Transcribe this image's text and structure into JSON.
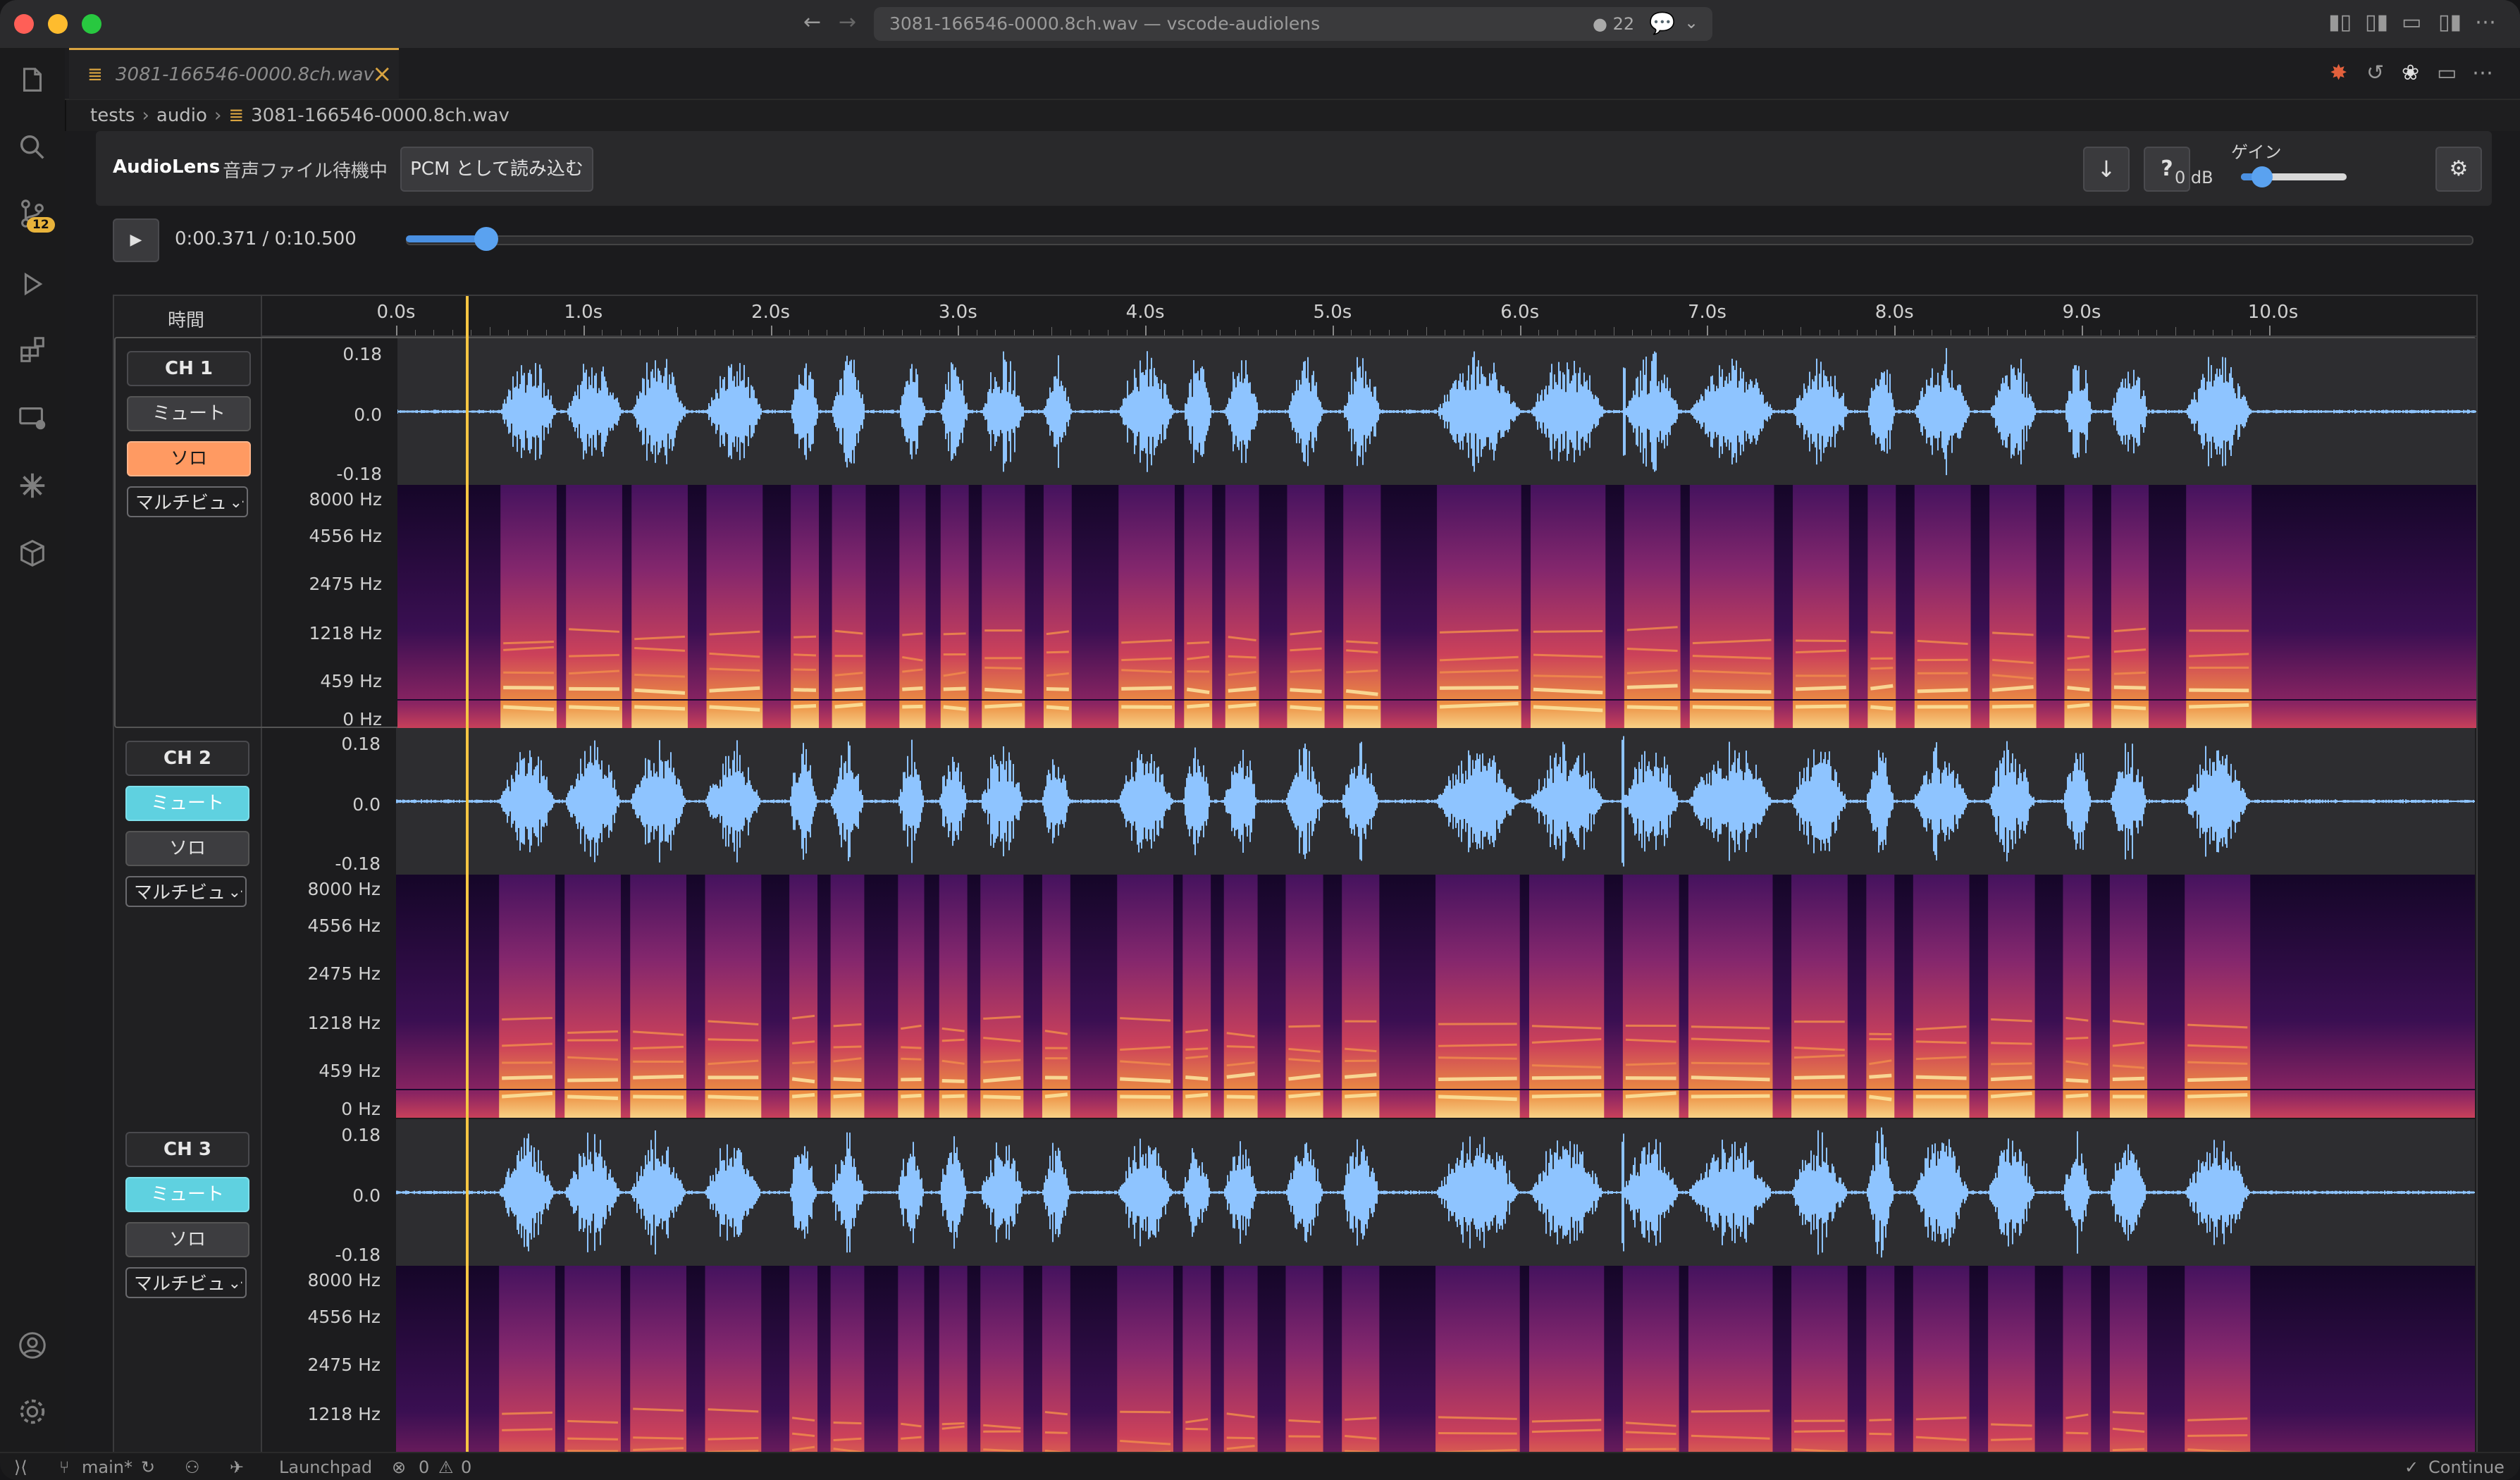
{
  "window": {
    "title": "3081-166546-0000.8ch.wav — vscode-audiolens",
    "notifications": "22",
    "traffic_colors": [
      "#ff5f57",
      "#febc2e",
      "#28c840"
    ]
  },
  "activity": {
    "scm_badge": "12"
  },
  "tab": {
    "label": "3081-166546-0000.8ch.wav"
  },
  "breadcrumb": {
    "items": [
      "tests",
      "audio",
      "3081-166546-0000.8ch.wav"
    ]
  },
  "toolbar": {
    "app_name": "AudioLens",
    "status": "音声ファイル待機中",
    "load_pcm_label": "PCM として読み込む",
    "download_icon": "↓",
    "help_label": "?",
    "gain_label": "ゲイン",
    "gain_value": "0 dB",
    "gain_level": 0.14,
    "settings_icon": "⚙"
  },
  "transport": {
    "play_icon": "▶",
    "time_display": "0:00.371 / 0:10.500",
    "progress": 0.0353
  },
  "timeline": {
    "header_label": "時間",
    "ticks": [
      "0.0s",
      "1.0s",
      "2.0s",
      "3.0s",
      "4.0s",
      "5.0s",
      "6.0s",
      "7.0s",
      "8.0s",
      "9.0s",
      "10.0s"
    ],
    "duration_s": 10.5,
    "cursor_s": 0.371
  },
  "amplitude_axis": [
    "0.18",
    "0.0",
    "-0.18"
  ],
  "frequency_axis": [
    "8000 Hz",
    "4556 Hz",
    "2475 Hz",
    "1218 Hz",
    "459 Hz",
    "0 Hz"
  ],
  "channels": [
    {
      "label": "CH 1",
      "mute_label": "ミュート",
      "solo_label": "ソロ",
      "mute_active": false,
      "solo_active": true,
      "view_mode": "マルチビュー"
    },
    {
      "label": "CH 2",
      "mute_label": "ミュート",
      "solo_label": "ソロ",
      "mute_active": true,
      "solo_active": false,
      "view_mode": "マルチビュー"
    },
    {
      "label": "CH 3",
      "mute_label": "ミュート",
      "solo_label": "ソロ",
      "mute_active": true,
      "solo_active": false,
      "view_mode": "マルチビュー"
    }
  ],
  "colors": {
    "waveform": "#8ec4ff",
    "cursor": "#f5c542",
    "solo_active": "#ff9a62",
    "mute_active": "#5fd1e0",
    "accent_tab": "#d9a441"
  },
  "status_bar": {
    "branch": "main*",
    "launchpad": "Launchpad",
    "errors": "0",
    "warnings": "0",
    "continue": "Continue"
  }
}
